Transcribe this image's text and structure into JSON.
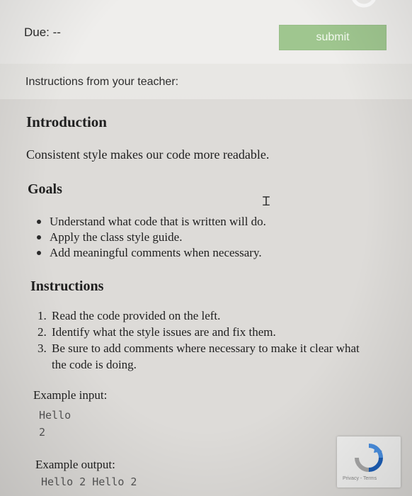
{
  "header": {
    "due_label": "Due: --",
    "submit_label": "submit",
    "logo_icon": "brand-logo-icon"
  },
  "instructions_from": "Instructions from your teacher:",
  "assignment": {
    "intro_heading": "Introduction",
    "intro_text": "Consistent style makes our code more readable.",
    "goals_heading": "Goals",
    "goals": [
      "Understand what code that is written will do.",
      "Apply the class style guide.",
      "Add meaningful comments when necessary."
    ],
    "instructions_heading": "Instructions",
    "instructions": [
      {
        "num": "1.",
        "text": "Read the code provided on the left."
      },
      {
        "num": "2.",
        "text": "Identify what the style issues are and fix them."
      },
      {
        "num": "3.",
        "text": "Be sure to add comments where necessary to make it clear what the code is doing."
      }
    ],
    "example_input_label": "Example input:",
    "example_input_lines": [
      "Hello",
      "2"
    ],
    "example_output_label": "Example output:",
    "example_output_lines": [
      "Hello 2 Hello 2"
    ]
  },
  "recaptcha": {
    "links_text": "Privacy - Terms",
    "icon": "recaptcha-icon"
  },
  "colors": {
    "submit_bg": "#9fc68f",
    "background": "#e8e6e3"
  }
}
